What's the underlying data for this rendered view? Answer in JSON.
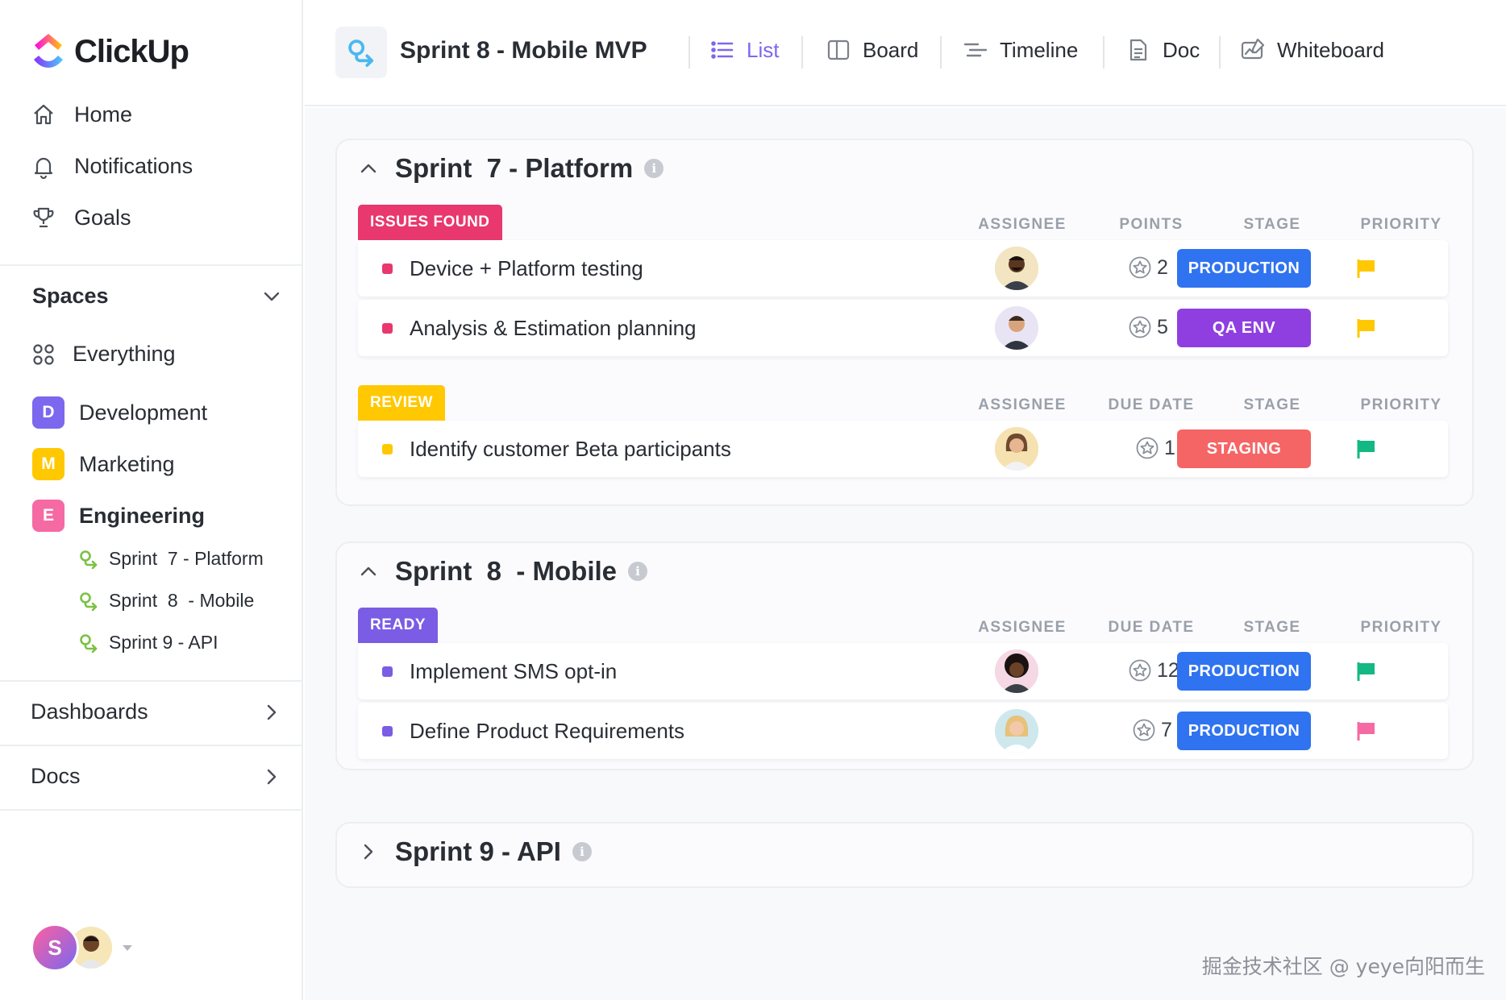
{
  "app": {
    "logo_text": "ClickUp"
  },
  "sidebar": {
    "nav": [
      {
        "label": "Home",
        "icon": "home-icon"
      },
      {
        "label": "Notifications",
        "icon": "bell-icon"
      },
      {
        "label": "Goals",
        "icon": "trophy-icon"
      }
    ],
    "spaces_label": "Spaces",
    "everything_label": "Everything",
    "spaces": [
      {
        "letter": "D",
        "label": "Development",
        "color": "#7b68ee"
      },
      {
        "letter": "M",
        "label": "Marketing",
        "color": "#ffc800"
      },
      {
        "letter": "E",
        "label": "Engineering",
        "color": "#f56aa3"
      }
    ],
    "sprints": [
      "Sprint  7 - Platform",
      "Sprint  8  - Mobile",
      "Sprint 9 - API"
    ],
    "dashboards_label": "Dashboards",
    "docs_label": "Docs",
    "user_initial": "S"
  },
  "header": {
    "title": "Sprint 8 - Mobile MVP",
    "tabs": [
      {
        "label": "List",
        "icon": "list-icon",
        "active": true
      },
      {
        "label": "Board",
        "icon": "board-icon",
        "active": false
      },
      {
        "label": "Timeline",
        "icon": "timeline-icon",
        "active": false
      },
      {
        "label": "Doc",
        "icon": "doc-icon",
        "active": false
      },
      {
        "label": "Whiteboard",
        "icon": "whiteboard-icon",
        "active": false
      }
    ]
  },
  "sprints": [
    {
      "title": "Sprint  7 - Platform",
      "groups": [
        {
          "tag": "ISSUES FOUND",
          "tag_color": "#e8386d",
          "columns": [
            "ASSIGNEE",
            "POINTS",
            "STAGE",
            "PRIORITY"
          ],
          "tasks": [
            {
              "name": "Device + Platform testing",
              "points": "2",
              "stage": "PRODUCTION",
              "stage_color": "#2f73f0",
              "priority_color": "#ffc800"
            },
            {
              "name": "Analysis & Estimation planning",
              "points": "5",
              "stage": "QA ENV",
              "stage_color": "#8f3fe0",
              "priority_color": "#ffc800"
            }
          ]
        },
        {
          "tag": "REVIEW",
          "tag_color": "#ffc800",
          "columns": [
            "ASSIGNEE",
            "DUE DATE",
            "STAGE",
            "PRIORITY"
          ],
          "tasks": [
            {
              "name": "Identify customer Beta participants",
              "points": "1",
              "stage": "STAGING",
              "stage_color": "#f56565",
              "priority_color": "#14b882"
            }
          ]
        }
      ]
    },
    {
      "title": "Sprint  8  - Mobile",
      "groups": [
        {
          "tag": "READY",
          "tag_color": "#7b5ce5",
          "columns": [
            "ASSIGNEE",
            "DUE DATE",
            "STAGE",
            "PRIORITY"
          ],
          "tasks": [
            {
              "name": "Implement SMS opt-in",
              "points": "12",
              "stage": "PRODUCTION",
              "stage_color": "#2f73f0",
              "priority_color": "#14b882"
            },
            {
              "name": "Define Product Requirements",
              "points": "7",
              "stage": "PRODUCTION",
              "stage_color": "#2f73f0",
              "priority_color": "#f56aa3"
            }
          ]
        }
      ]
    },
    {
      "title": "Sprint 9 - API",
      "groups": []
    }
  ],
  "watermark": "掘金技术社区 @ yeye向阳而生"
}
